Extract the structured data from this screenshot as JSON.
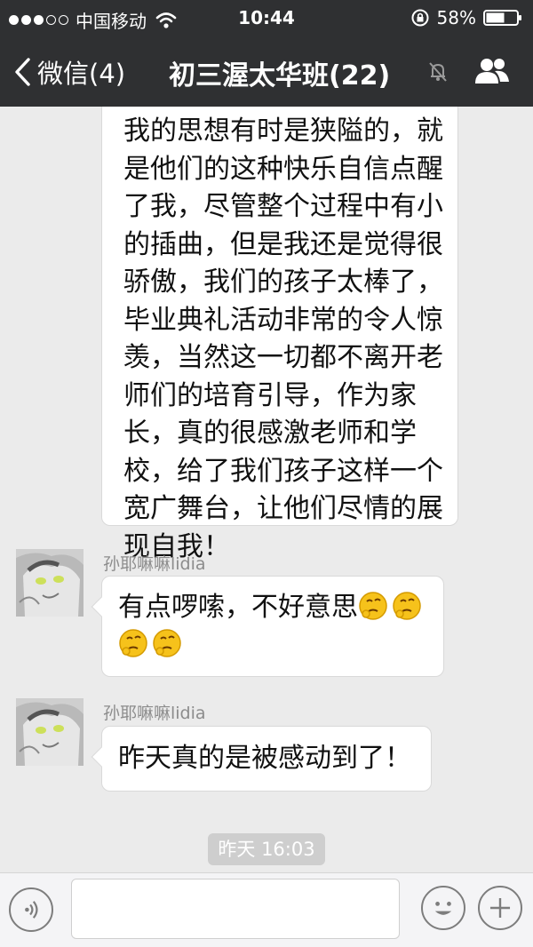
{
  "status_bar": {
    "carrier": "中国移动",
    "time": "10:44",
    "battery": "58%",
    "signal_strength": 3
  },
  "nav": {
    "back_label": "微信(4)",
    "title": "初三渥太华班(22)"
  },
  "messages": {
    "long_text_lines": [
      "我的思想有时是狭隘的，就",
      "是他们的这种快乐自信点醒",
      "了我，尽管整个过程中有小",
      "的插曲，但是我还是觉得很",
      "骄傲，我们的孩子太棒了，",
      "毕业典礼活动非常的令人惊",
      "羡，当然这一切都不离开老",
      "师们的培育引导，作为家",
      "长，真的很感激老师和学",
      "校，给了我们孩子这样一个",
      "宽广舞台，让他们尽情的展",
      "现自我！"
    ],
    "msg2": {
      "sender": "孙耶嘛嘛lidia",
      "text": "有点啰嗦，不好意思"
    },
    "msg3": {
      "sender": "孙耶嘛嘛lidia",
      "text": "昨天真的是被感动到了！"
    }
  },
  "timestamp": "昨天 16:03",
  "colors": {
    "header_bg": "#2f3032",
    "chat_bg": "#ebebeb",
    "bubble_bg": "#ffffff",
    "timestamp_bg": "#cecece"
  },
  "icons": [
    "wifi-icon",
    "lock-rotation-icon",
    "battery-icon",
    "back-chevron-icon",
    "mute-icon",
    "group-icon",
    "emoji-think-icon",
    "voice-icon",
    "emoji-icon",
    "plus-icon"
  ]
}
